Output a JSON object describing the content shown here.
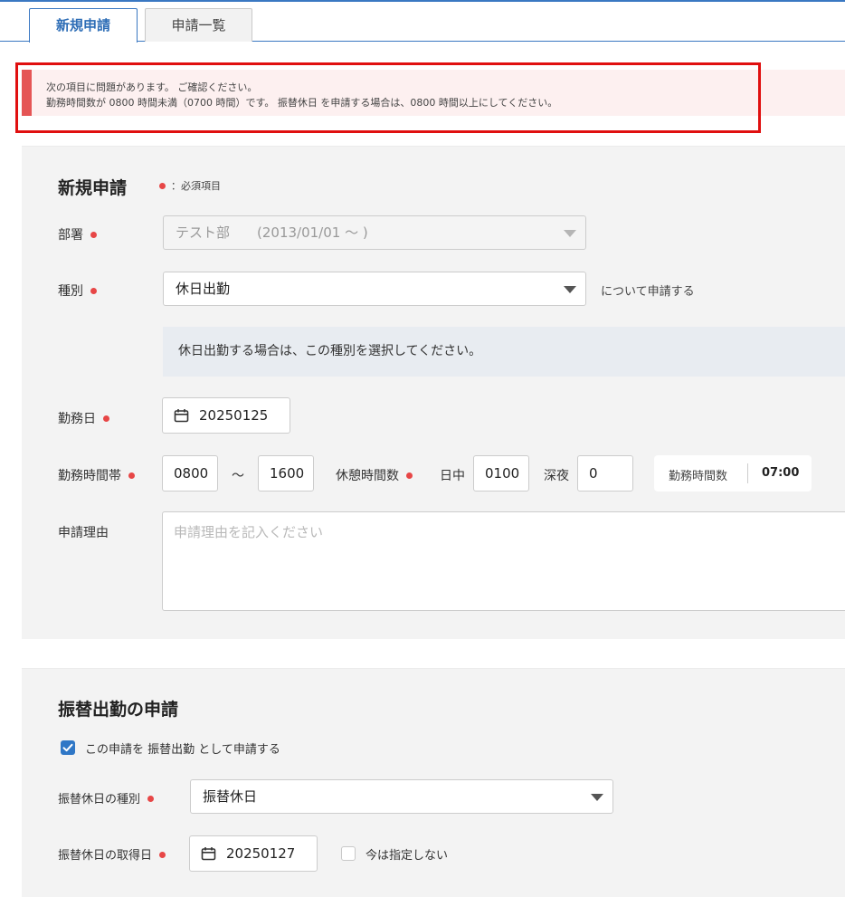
{
  "tabs": [
    {
      "label": "新規申請",
      "active": true
    },
    {
      "label": "申請一覧",
      "active": false
    }
  ],
  "error": {
    "line1": "次の項目に問題があります。 ご確認ください。",
    "line2": "勤務時間数が 0800 時間未満（0700 時間）です。 振替休日 を申請する場合は、0800 時間以上にしてください。"
  },
  "form": {
    "title": "新規申請",
    "required_legend": "：必須項目",
    "department": {
      "label": "部署",
      "value": "テスト部　　(2013/01/01 ～ )"
    },
    "category": {
      "label": "種別",
      "value": "休日出勤",
      "suffix": "について申請する"
    },
    "note": "休日出勤する場合は、この種別を選択してください。",
    "work_date": {
      "label": "勤務日",
      "value": "20250125"
    },
    "work_hours": {
      "label": "勤務時間帯",
      "start": "0800",
      "separator": "～",
      "end": "1600",
      "break_label": "休憩時間数",
      "day_label": "日中",
      "day_value": "0100",
      "night_label": "深夜",
      "night_value": "0",
      "total_label": "勤務時間数",
      "total_value": "07:00"
    },
    "reason": {
      "label": "申請理由",
      "placeholder": "申請理由を記入ください"
    }
  },
  "substitute": {
    "title": "振替出勤の申請",
    "apply_checkbox_label": "この申請を 振替出勤 として申請する",
    "apply_checked": true,
    "type": {
      "label": "振替休日の種別",
      "value": "振替休日"
    },
    "date": {
      "label": "振替休日の取得日",
      "value": "20250127"
    },
    "unspecified_label": "今は指定しない",
    "unspecified_checked": false
  },
  "colors": {
    "accent": "#3a78c2",
    "required_dot": "#e74646",
    "error_bar": "#e55555",
    "error_bg": "#fdf0f0",
    "highlight_frame": "#e00f0f"
  }
}
